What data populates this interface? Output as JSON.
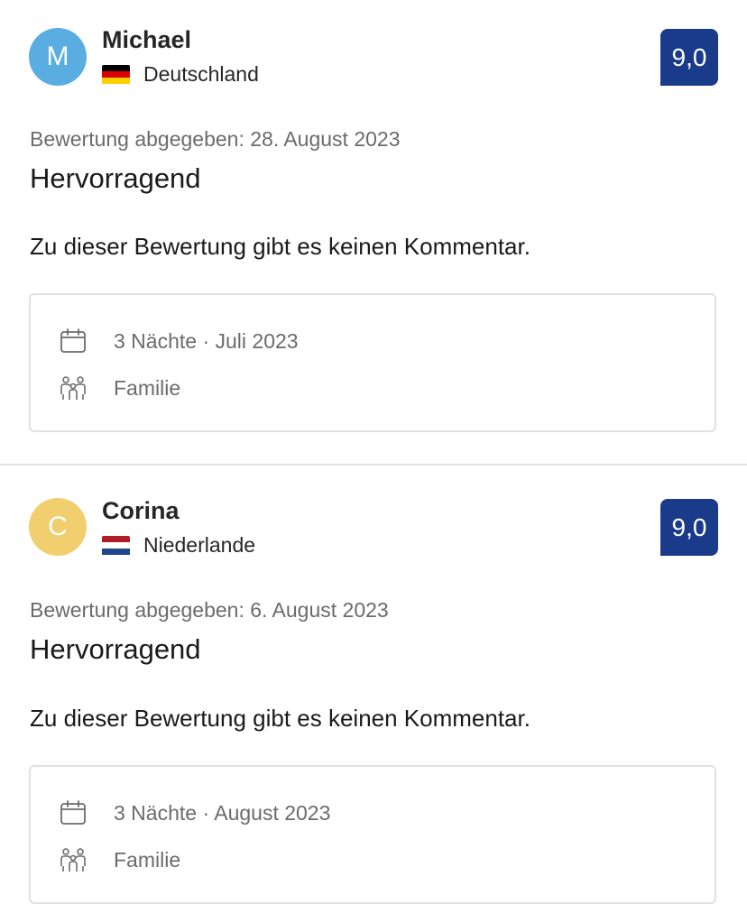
{
  "reviews": [
    {
      "avatar_letter": "M",
      "avatar_color": "#5aade1",
      "name": "Michael",
      "country": "Deutschland",
      "flag_colors": [
        "#000000",
        "#dd0000",
        "#ffce00"
      ],
      "flag_icon": "germany-flag-icon",
      "score": "9,0",
      "date": "Bewertung abgegeben: 28. August 2023",
      "headline": "Hervorragend",
      "comment": "Zu dieser Bewertung gibt es keinen Kommentar.",
      "stay_duration": "3 Nächte · Juli 2023",
      "traveler_type": "Familie"
    },
    {
      "avatar_letter": "C",
      "avatar_color": "#f1cf6e",
      "name": "Corina",
      "country": "Niederlande",
      "flag_colors": [
        "#ae1c28",
        "#ffffff",
        "#21468b"
      ],
      "flag_icon": "netherlands-flag-icon",
      "score": "9,0",
      "date": "Bewertung abgegeben: 6. August 2023",
      "headline": "Hervorragend",
      "comment": "Zu dieser Bewertung gibt es keinen Kommentar.",
      "stay_duration": "3 Nächte · August 2023",
      "traveler_type": "Familie"
    }
  ],
  "colors": {
    "score_badge": "#1a3a8a",
    "muted_text": "#6b6b6b",
    "divider": "#e3e3e3"
  },
  "icons": {
    "stay_duration": "calendar-icon",
    "traveler_type": "family-icon"
  }
}
